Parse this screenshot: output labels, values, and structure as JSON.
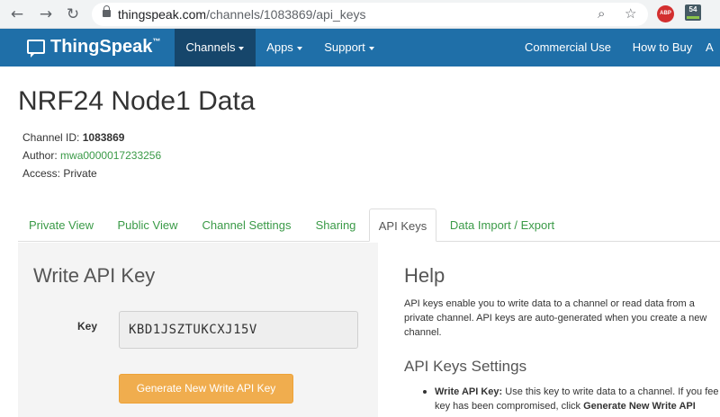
{
  "browser": {
    "back_icon": "arrow-left-icon",
    "forward_icon": "arrow-right-icon",
    "reload_icon": "reload-icon",
    "url_host": "thingspeak.com",
    "url_path": "/channels/1083869/api_keys",
    "zoom_icon": "zoom-icon",
    "bookmark_icon": "star-icon",
    "ext_abp_label": "ABP",
    "ext_54_label": "54"
  },
  "navbar": {
    "brand": "ThingSpeak",
    "brand_tm": "™",
    "items": [
      {
        "label": "Channels",
        "has_caret": true,
        "active": true
      },
      {
        "label": "Apps",
        "has_caret": true,
        "active": false
      },
      {
        "label": "Support",
        "has_caret": true,
        "active": false
      },
      {
        "label": "Commercial Use",
        "has_caret": false,
        "active": false
      },
      {
        "label": "How to Buy",
        "has_caret": false,
        "active": false
      },
      {
        "label": "A",
        "has_caret": false,
        "active": false
      }
    ],
    "colors": {
      "bar": "#1f6fa8",
      "active": "#16466b"
    }
  },
  "channel": {
    "title": "NRF24 Node1 Data",
    "id_label": "Channel ID:",
    "id_value": "1083869",
    "author_label": "Author:",
    "author_value": "mwa0000017233256",
    "access_label": "Access:",
    "access_value": "Private"
  },
  "tabs": [
    {
      "label": "Private View",
      "active": false
    },
    {
      "label": "Public View",
      "active": false
    },
    {
      "label": "Channel Settings",
      "active": false
    },
    {
      "label": "Sharing",
      "active": false
    },
    {
      "label": "API Keys",
      "active": true
    },
    {
      "label": "Data Import / Export",
      "active": false
    }
  ],
  "write_key": {
    "heading": "Write API Key",
    "key_label": "Key",
    "key_value": "KBD1JSZTUKCXJ15V",
    "generate_button": "Generate New Write API Key",
    "button_color": "#f0ad4e"
  },
  "help": {
    "heading": "Help",
    "text": "API keys enable you to write data to a channel or read data from a private channel. API keys are auto-generated when you create a new channel.",
    "settings_heading": "API Keys Settings",
    "bullet_term": "Write API Key:",
    "bullet_text": "Use this key to write data to a channel. If you fee your key has been compromised, click",
    "bullet_tail": "Generate New Write API"
  },
  "colors": {
    "link_green": "#3a9a47"
  }
}
